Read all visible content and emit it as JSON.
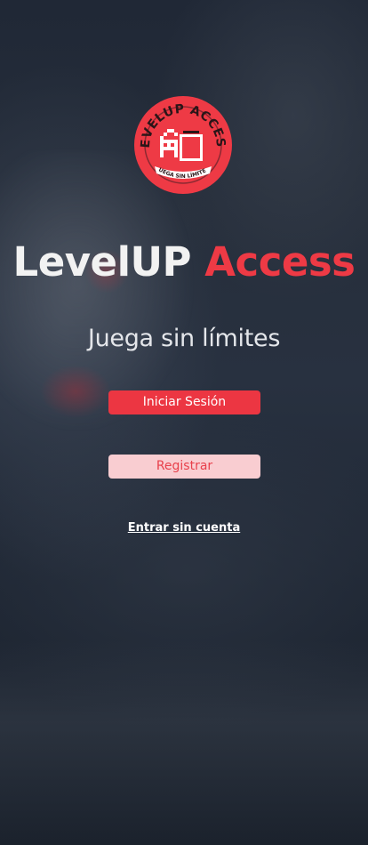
{
  "logo": {
    "ring_text": "LEVELUP ACCESS",
    "bottom_text": "JUEGA SIN LÍMITES",
    "icon": "pixel-character-icon"
  },
  "title": {
    "part1": "LevelUP",
    "part2": "Access"
  },
  "tagline": "Juega sin límites",
  "buttons": {
    "login": "Iniciar Sesión",
    "register": "Registrar"
  },
  "guest_link": "Entrar sin cuenta",
  "colors": {
    "accent": "#ec3642",
    "accent_light": "#f9cdd1",
    "background": "#232b38",
    "text": "#f2f2f2"
  }
}
